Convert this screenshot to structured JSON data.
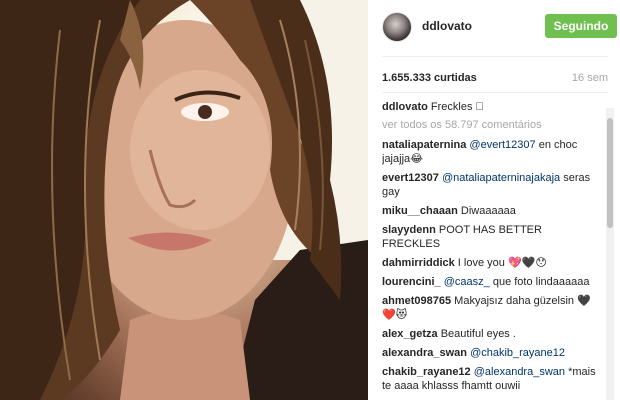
{
  "post": {
    "username": "ddlovato",
    "follow_label": "Seguindo",
    "likes_text": "1.655.333 curtidas",
    "time_text": "16 sem",
    "caption_user": "ddlovato",
    "caption_text": "Freckles 🏻",
    "view_all_text": "ver todos os 58.797 comentários"
  },
  "comments": [
    {
      "user": "nataliapaternina",
      "mention": "@evert12307",
      "text": " en choc jajajja😂"
    },
    {
      "user": "evert12307",
      "mention": "@nataliapaterninajakaja",
      "text": " seras gay"
    },
    {
      "user": "miku__chaaan",
      "mention": "",
      "text": " Diwaaaaaa"
    },
    {
      "user": "slayydenn",
      "mention": "",
      "text": " POOT HAS BETTER FRECKLES"
    },
    {
      "user": "dahmirriddick",
      "mention": "",
      "text": " I love you 💖🖤😯"
    },
    {
      "user": "lourencini_",
      "mention": "@caasz_",
      "text": " que foto lindaaaaaa"
    },
    {
      "user": "ahmet098765",
      "mention": "",
      "text": " Makyajsız daha güzelsin 🖤❤️😻"
    },
    {
      "user": "alex_getza",
      "mention": "",
      "text": " Beautiful eyes ."
    },
    {
      "user": "alexandra_swan",
      "mention": "@chakib_rayane12",
      "text": ""
    },
    {
      "user": "chakib_rayane12",
      "mention": "@alexandra_swan",
      "text": " *mais te aaaa khlasss fhamtt ouwii"
    }
  ],
  "colors": {
    "follow_green": "#70c050",
    "mention_blue": "#003569",
    "muted_gray": "#a5a7aa"
  }
}
